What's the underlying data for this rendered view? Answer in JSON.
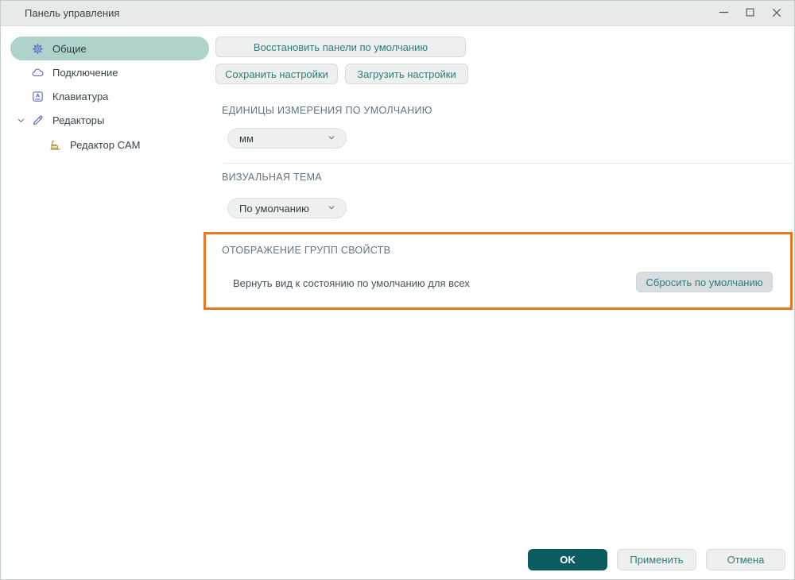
{
  "window": {
    "title": "Панель управления"
  },
  "sidebar": {
    "items": [
      {
        "label": "Общие",
        "icon": "gear-icon",
        "selected": true
      },
      {
        "label": "Подключение",
        "icon": "cloud-icon",
        "selected": false
      },
      {
        "label": "Клавиатура",
        "icon": "keyboard-icon",
        "selected": false
      },
      {
        "label": "Редакторы",
        "icon": "pencil-icon",
        "selected": false,
        "expanded": true
      },
      {
        "label": "Редактор CAM",
        "icon": "factory-icon",
        "selected": false,
        "child_of": "Редакторы"
      }
    ]
  },
  "toolbar": {
    "restore_panels": "Восстановить панели по умолчанию",
    "save_settings": "Сохранить настройки",
    "load_settings": "Загрузить настройки"
  },
  "sections": {
    "units": {
      "title": "ЕДИНИЦЫ ИЗМЕРЕНИЯ ПО УМОЛЧАНИЮ",
      "value": "мм"
    },
    "theme": {
      "title": "ВИЗУАЛЬНАЯ ТЕМА",
      "value": "По умолчанию"
    },
    "property_groups": {
      "title": "ОТОБРАЖЕНИЕ ГРУПП СВОЙСТВ",
      "description": "Вернуть вид к состоянию по умолчанию для всех",
      "reset_button": "Сбросить по умолчанию"
    }
  },
  "footer": {
    "ok": "OK",
    "apply": "Применить",
    "cancel": "Отмена"
  },
  "colors": {
    "accent_teal": "#2d7d78",
    "ok_button": "#0a5c61",
    "selected_item_bg": "#aed3cd",
    "highlight_border": "#e8771f",
    "icon_indigo": "#5b6abf",
    "icon_olive": "#a1881f",
    "titlebar_bg": "#e7eae9"
  }
}
